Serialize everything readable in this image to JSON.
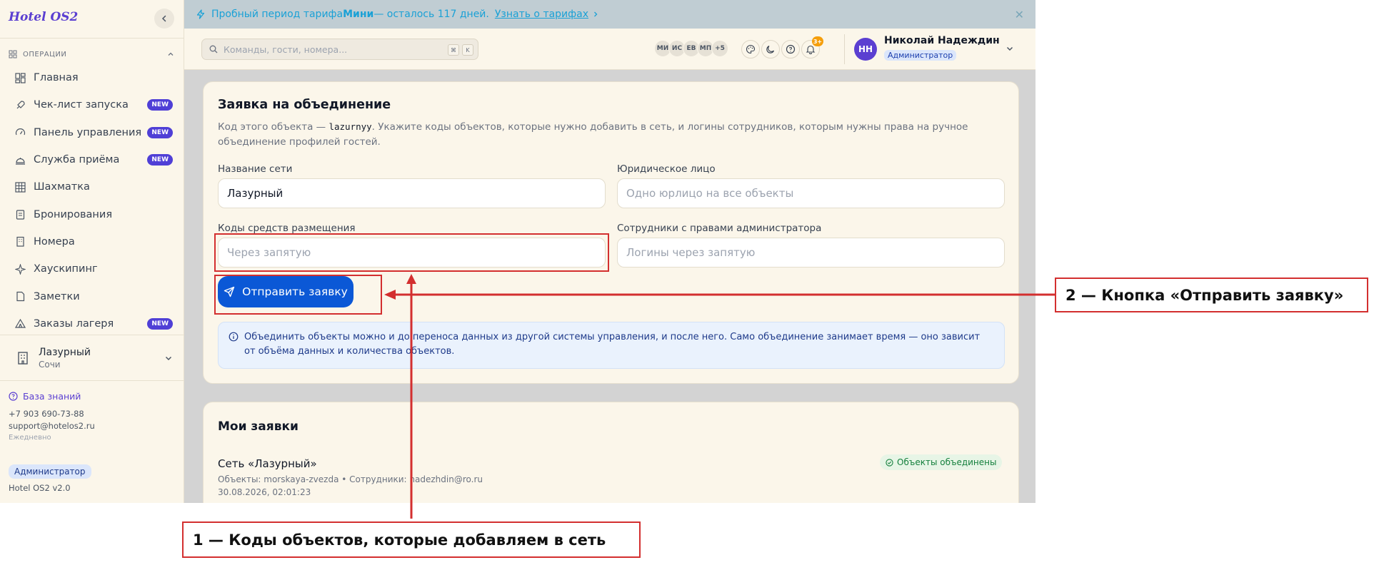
{
  "colors": {
    "accent": "#5b3fd1",
    "primary_button": "#0b58d6",
    "annotation": "#d32f2f",
    "banner_text": "#1aa1d6"
  },
  "sidebar": {
    "brand": "Hotel OS2",
    "section_title": "ОПЕРАЦИИ",
    "items": [
      {
        "label": "Главная",
        "icon": "dashboard-icon",
        "badge": ""
      },
      {
        "label": "Чек-лист запуска",
        "icon": "rocket-icon",
        "badge": "NEW"
      },
      {
        "label": "Панель управления",
        "icon": "gauge-icon",
        "badge": "NEW"
      },
      {
        "label": "Служба приёма",
        "icon": "bell-desk-icon",
        "badge": "NEW"
      },
      {
        "label": "Шахматка",
        "icon": "grid-icon",
        "badge": ""
      },
      {
        "label": "Бронирования",
        "icon": "clipboard-icon",
        "badge": ""
      },
      {
        "label": "Номера",
        "icon": "building-icon",
        "badge": ""
      },
      {
        "label": "Хаускипинг",
        "icon": "sparkle-icon",
        "badge": ""
      },
      {
        "label": "Заметки",
        "icon": "note-icon",
        "badge": ""
      },
      {
        "label": "Заказы лагеря",
        "icon": "tent-icon",
        "badge": "NEW"
      }
    ],
    "hotel": {
      "name": "Лазурный",
      "city": "Сочи"
    },
    "footer": {
      "kb_link": "База знаний",
      "phone": "+7 903 690-73-88",
      "email": "support@hotelos2.ru",
      "hours": "Ежедневно",
      "role": "Администратор",
      "version": "Hotel OS2 v2.0"
    }
  },
  "banner": {
    "prefix": "Пробный период тарифа ",
    "plan": "Мини",
    "suffix": " — осталось 117 дней.",
    "link": "Узнать о тарифах"
  },
  "topbar": {
    "search_placeholder": "Команды, гости, номера...",
    "kbd_keys": [
      "⌘",
      "K"
    ],
    "avatars": [
      "МИ",
      "ИС",
      "ЕВ",
      "МП",
      "+5"
    ],
    "notif_count": "3+",
    "user": {
      "initials": "НН",
      "name": "Николай Надеждин",
      "role": "Администратор"
    }
  },
  "form": {
    "title": "Заявка на объединение",
    "desc_prefix": "Код этого объекта — ",
    "object_code": "lazurnyy",
    "desc_suffix": ". Укажите коды объектов, которые нужно добавить в сеть, и логины сотрудников, которым нужны права на ручное объединение профилей гостей.",
    "network_name_label": "Название сети",
    "network_name_value": "Лазурный",
    "legal_entity_label": "Юридическое лицо",
    "legal_entity_placeholder": "Одно юрлицо на все объекты",
    "codes_label": "Коды средств размещения",
    "codes_placeholder": "Через запятую",
    "admins_label": "Сотрудники с правами администратора",
    "admins_placeholder": "Логины через запятую",
    "submit_label": "Отправить заявку",
    "info_text": "Объединить объекты можно и до переноса данных из другой системы управления, и после него. Само объединение занимает время — оно зависит от объёма данных и количества объектов."
  },
  "requests": {
    "title": "Мои заявки",
    "items": [
      {
        "title": "Сеть «Лазурный»",
        "meta": "Объекты: morskaya-zvezda • Сотрудники: nadezhdin@ro.ru",
        "date": "30.08.2026, 02:01:23",
        "status": "Объекты объединены"
      }
    ]
  },
  "annotations": {
    "callout_1": "1 — Коды объектов, которые добавляем в сеть",
    "callout_2": "2 — Кнопка «Отправить заявку»"
  }
}
